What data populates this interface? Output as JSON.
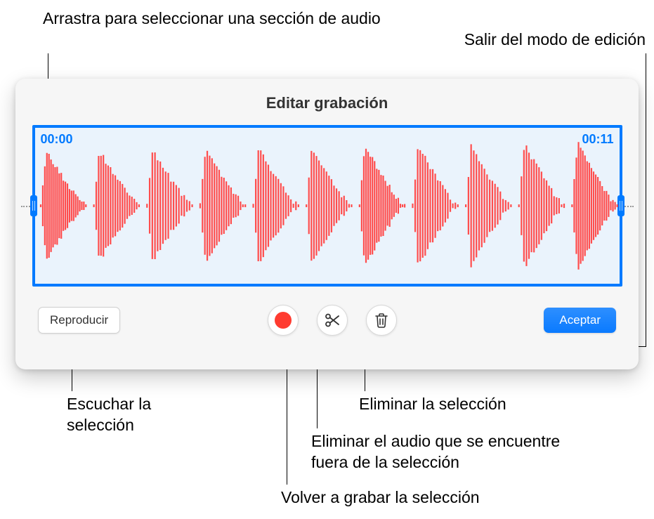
{
  "callouts": {
    "drag_select": "Arrastra para seleccionar una sección de audio",
    "exit_edit": "Salir del modo de edición",
    "listen": "Escuchar la selección",
    "rerecord": "Volver a grabar la selección",
    "trim_outside": "Eliminar el audio que se encuentre fuera de la selección",
    "delete_sel": "Eliminar la selección"
  },
  "panel": {
    "title": "Editar grabación",
    "time_start": "00:00",
    "time_end": "00:11"
  },
  "buttons": {
    "play": "Reproducir",
    "accept": "Aceptar"
  }
}
